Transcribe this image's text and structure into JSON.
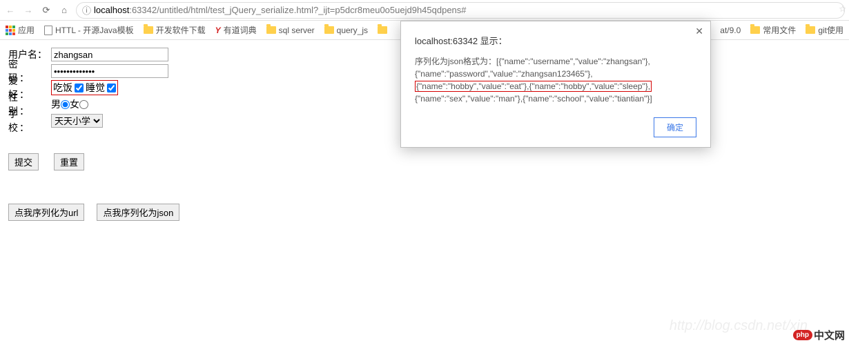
{
  "url": {
    "host": "localhost",
    "rest": ":63342/untitled/html/test_jQuery_serialize.html?_ijt=p5dcr8meu0o5uejd9h45qdpens#"
  },
  "bookmarks": {
    "apps": "应用",
    "items": [
      "HTTL - 开源Java模板",
      "开发软件下载",
      "有道词典",
      "sql server",
      "query_js",
      "at/9.0",
      "常用文件",
      "git使用"
    ]
  },
  "form": {
    "username_label": "用户名：",
    "username_value": "zhangsan",
    "password_label": "密　码：",
    "password_value": "•••••••••••••",
    "hobby_label": "爱　好：",
    "hobby_eat": "吃饭",
    "hobby_sleep": "睡觉",
    "sex_label": "性　别：",
    "sex_male": "男",
    "sex_female": "女",
    "school_label": "学　校：",
    "school_selected": "天天小学",
    "submit": "提交",
    "reset": "重置",
    "serialize_url_btn": "点我序列化为url",
    "serialize_json_btn": "点我序列化为json"
  },
  "dialog": {
    "title": "localhost:63342 显示：",
    "line_prefix": "序列化为json格式为：",
    "line1": "[{\"name\":\"username\",\"value\":\"zhangsan\"},",
    "line2": "{\"name\":\"password\",\"value\":\"zhangsan123465\"},",
    "line3": "{\"name\":\"hobby\",\"value\":\"eat\"},{\"name\":\"hobby\",\"value\":\"sleep\"},",
    "line4": "{\"name\":\"sex\",\"value\":\"man\"},{\"name\":\"school\",\"value\":\"tiantian\"}]",
    "ok": "确定"
  },
  "watermark": "http://blog.csdn.net/xin",
  "brand": {
    "pill": "php",
    "text": "中文网"
  }
}
